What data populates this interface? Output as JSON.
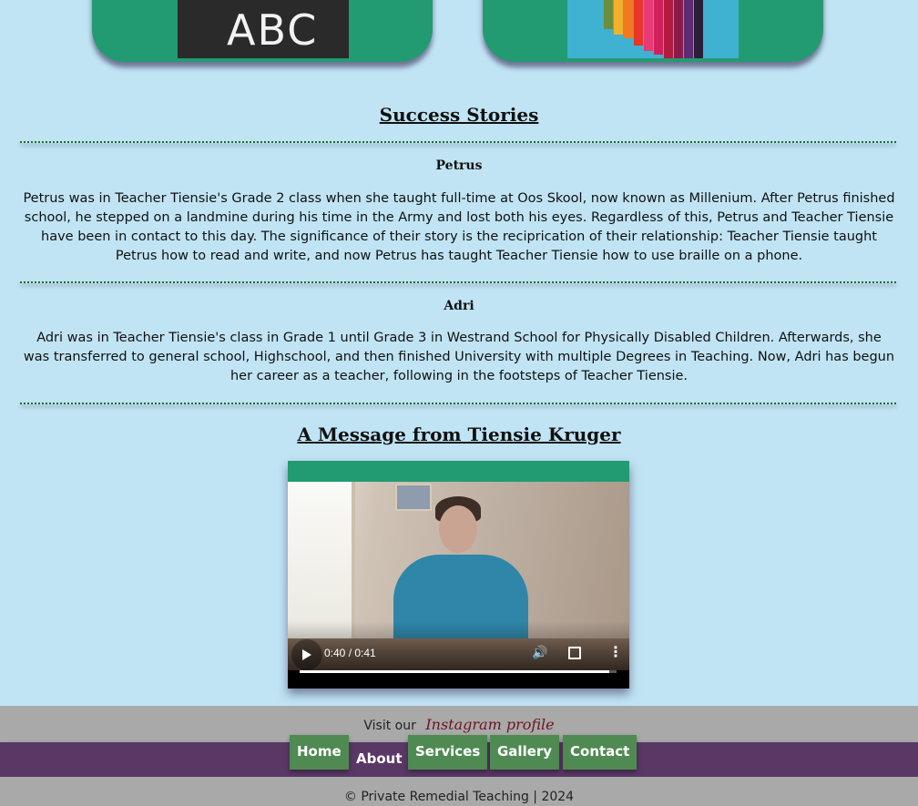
{
  "cards": {
    "left_image_text": "ABC",
    "left_image_label": "chalkboard-abc-image",
    "right_image_label": "colored-pencils-image"
  },
  "success": {
    "title": "Success Stories",
    "stories": [
      {
        "name": "Petrus",
        "text": "Petrus was in Teacher Tiensie's Grade 2 class when she taught full-time at Oos Skool, now known as Millenium. After Petrus finished school, he stepped on a landmine during his time in the Army and lost both his eyes. Regardless of this, Petrus and Teacher Tiensie have been in contact to this day. The significance of their story is the reciprication of their relationship: Teacher Tiensie taught Petrus how to read and write, and now Petrus has taught Teacher Tiensie how to use braille on a phone."
      },
      {
        "name": "Adri",
        "text": "Adri was in Teacher Tiensie's class in Grade 1 until Grade 3 in Westrand School for Physically Disabled Children. Afterwards, she was transferred to general school, Highschool, and then finished University with multiple Degrees in Teaching. Now, Adri has begun her career as a teacher, following in the footsteps of Teacher Tiensie."
      }
    ]
  },
  "message": {
    "title": "A Message from Tiensie Kruger",
    "video": {
      "time": "0:40 / 0:41",
      "progress": 0.976,
      "icons": [
        "play-icon",
        "volume-icon",
        "fullscreen-icon",
        "more-options-icon"
      ]
    }
  },
  "instagram": {
    "prefix": "Visit our",
    "link": "Instagram profile"
  },
  "nav": {
    "items": [
      "Home",
      "About",
      "Services",
      "Gallery",
      "Contact"
    ]
  },
  "footer": {
    "copyright": "© Private Remedial Teaching | 2024"
  },
  "colors": {
    "page_bg": "#c0e4f4",
    "card_green": "#239b72",
    "nav_purple": "#5a3866",
    "nav_button_green": "#4f8a53",
    "bar_grey": "#a9a9a9",
    "instagram_link": "#6b1520"
  }
}
